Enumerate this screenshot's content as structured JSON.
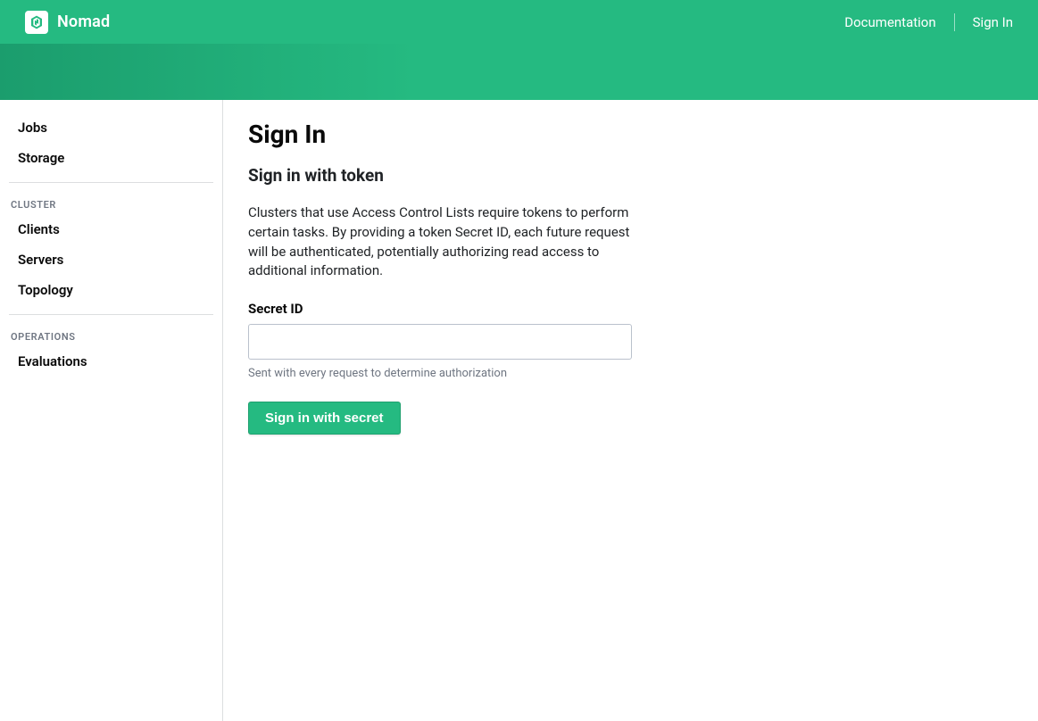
{
  "brand": {
    "name": "Nomad"
  },
  "topnav": {
    "documentation_label": "Documentation",
    "signin_label": "Sign In"
  },
  "sidebar": {
    "workloads": [
      {
        "label": "Jobs"
      },
      {
        "label": "Storage"
      }
    ],
    "cluster_heading": "CLUSTER",
    "cluster": [
      {
        "label": "Clients"
      },
      {
        "label": "Servers"
      },
      {
        "label": "Topology"
      }
    ],
    "operations_heading": "OPERATIONS",
    "operations": [
      {
        "label": "Evaluations"
      }
    ]
  },
  "main": {
    "page_title": "Sign In",
    "section_title": "Sign in with token",
    "help_text": "Clusters that use Access Control Lists require tokens to perform certain tasks. By providing a token Secret ID, each future request will be authenticated, potentially authorizing read access to additional information.",
    "field_label": "Secret ID",
    "input_value": "",
    "input_placeholder": "",
    "hint": "Sent with every request to determine authorization",
    "submit_label": "Sign in with secret"
  },
  "colors": {
    "brand_green": "#25ba81"
  }
}
